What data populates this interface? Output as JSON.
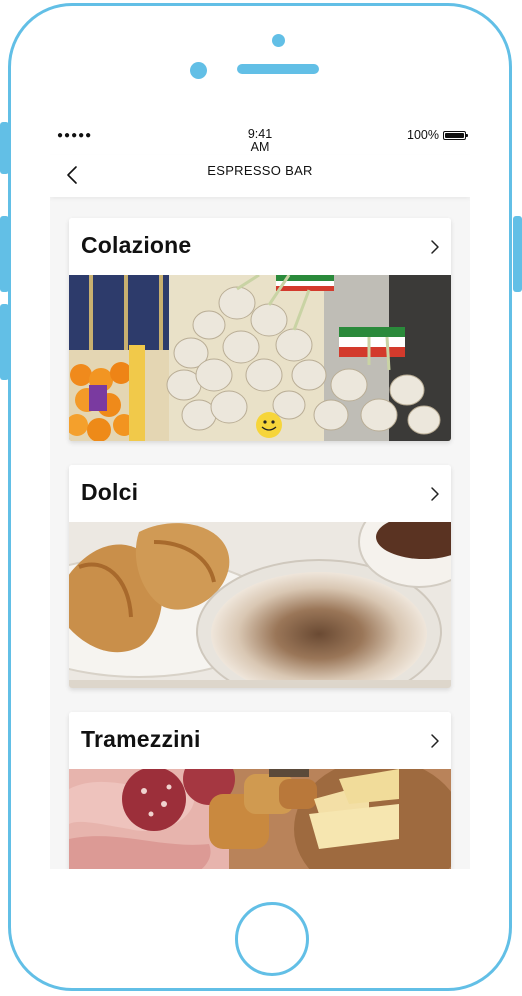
{
  "status_bar": {
    "signal": "●●●●●",
    "time_line1": "9:41",
    "time_line2": "AM",
    "battery_percent": "100%"
  },
  "nav": {
    "title": "ESPRESSO BAR",
    "back_icon": "chevron-left-icon"
  },
  "categories": [
    {
      "title": "Colazione",
      "image": "breakfast-market-photo",
      "icon": "chevron-right-icon"
    },
    {
      "title": "Dolci",
      "image": "cappuccino-croissant-photo",
      "icon": "chevron-right-icon"
    },
    {
      "title": "Tramezzini",
      "image": "charcuterie-cheese-photo",
      "icon": "chevron-right-icon"
    }
  ],
  "colors": {
    "device_outline": "#62bfe6",
    "background": "#f6f6f6",
    "text": "#111111"
  }
}
